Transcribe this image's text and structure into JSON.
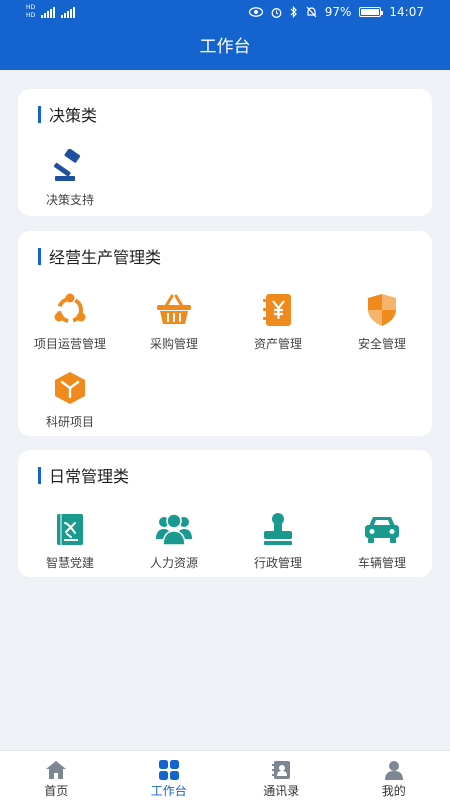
{
  "status_bar": {
    "sim1": "HD",
    "sim2": "HD",
    "battery": "97%",
    "time": "14:07"
  },
  "header": {
    "title": "工作台"
  },
  "sections": [
    {
      "title": "决策类",
      "items": [
        {
          "label": "决策支持",
          "icon": "gavel-icon",
          "color": "#1f4f9f"
        }
      ]
    },
    {
      "title": "经营生产管理类",
      "items": [
        {
          "label": "项目运营管理",
          "icon": "project-cycle-icon",
          "color": "#f08a1c"
        },
        {
          "label": "采购管理",
          "icon": "basket-icon",
          "color": "#f08a1c"
        },
        {
          "label": "资产管理",
          "icon": "yen-ledger-icon",
          "color": "#f08a1c"
        },
        {
          "label": "安全管理",
          "icon": "shield-icon",
          "color": "#f08a1c"
        },
        {
          "label": "科研项目",
          "icon": "cube-icon",
          "color": "#f08a1c"
        }
      ]
    },
    {
      "title": "日常管理类",
      "items": [
        {
          "label": "智慧党建",
          "icon": "party-book-icon",
          "color": "#1a9a8e"
        },
        {
          "label": "人力资源",
          "icon": "people-icon",
          "color": "#1a9a8e"
        },
        {
          "label": "行政管理",
          "icon": "stamp-icon",
          "color": "#1a9a8e"
        },
        {
          "label": "车辆管理",
          "icon": "car-icon",
          "color": "#1a9a8e"
        }
      ]
    }
  ],
  "tabs": [
    {
      "label": "首页",
      "icon": "home-icon",
      "active": false
    },
    {
      "label": "工作台",
      "icon": "grid-icon",
      "active": true
    },
    {
      "label": "通讯录",
      "icon": "contacts-icon",
      "active": false
    },
    {
      "label": "我的",
      "icon": "user-icon",
      "active": false
    }
  ],
  "colors": {
    "primary": "#1463cf",
    "orange": "#f08a1c",
    "teal": "#1a9a8e",
    "navy": "#1f4f9f"
  }
}
